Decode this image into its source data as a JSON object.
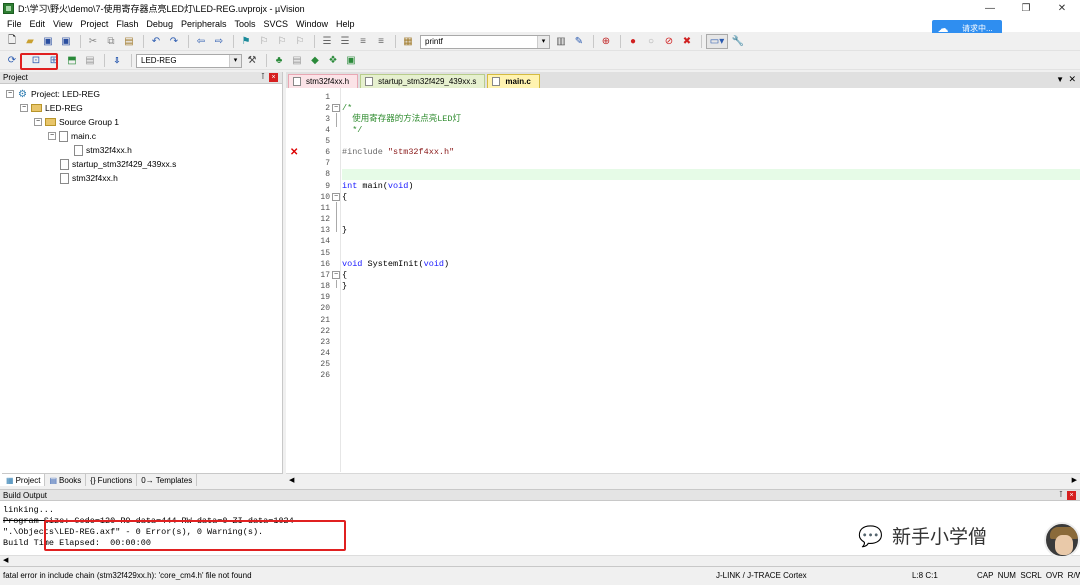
{
  "window": {
    "title": "D:\\学习\\野火\\demo\\7-使用寄存器点亮LED灯\\LED-REG.uvprojx - µVision"
  },
  "menu": [
    "File",
    "Edit",
    "View",
    "Project",
    "Flash",
    "Debug",
    "Peripherals",
    "Tools",
    "SVCS",
    "Window",
    "Help"
  ],
  "cloud_badge": {
    "label": "请求中..."
  },
  "toolbar": {
    "find_value": "printf",
    "target_value": "LED-REG"
  },
  "project_panel": {
    "title": "Project",
    "tree": {
      "project": "Project: LED-REG",
      "target": "LED-REG",
      "group": "Source Group 1",
      "files": [
        "main.c",
        "stm32f4xx.h",
        "startup_stm32f429_439xx.s",
        "stm32f4xx.h"
      ]
    },
    "tabs": [
      "Project",
      "Books",
      "Functions",
      "Templates"
    ]
  },
  "editor": {
    "tabs": [
      "stm32f4xx.h",
      "startup_stm32f429_439xx.s",
      "main.c"
    ],
    "line_numbers": [
      "1",
      "2",
      "3",
      "4",
      "5",
      "6",
      "7",
      "8",
      "9",
      "10",
      "11",
      "12",
      "13",
      "14",
      "15",
      "16",
      "17",
      "18",
      "19",
      "20",
      "21",
      "22",
      "23",
      "24",
      "25",
      "26"
    ],
    "code": {
      "l2": "/*",
      "l3": "  使用寄存器的方法点亮LED灯",
      "l4": "  */",
      "l6_pp": "#include ",
      "l6_str": "\"stm32f4xx.h\"",
      "l9_kw": "int",
      "l9_mid": " main(",
      "l9_kw2": "void",
      "l9_end": ")",
      "l10": "{",
      "l13": "}",
      "l16_kw": "void",
      "l16_mid": " SystemInit(",
      "l16_kw2": "void",
      "l16_end": ")",
      "l17": "{",
      "l18": "}"
    }
  },
  "build_output": {
    "title": "Build Output",
    "lines": [
      "linking...",
      "Program Size: Code=120 RO-data=444 RW-data=0 ZI-data=1024",
      "\".\\Objects\\LED-REG.axf\" - 0 Error(s), 0 Warning(s).",
      "Build Time Elapsed:  00:00:00"
    ]
  },
  "status_bar": {
    "message": "fatal error in include chain (stm32f429xx.h): 'core_cm4.h' file not found",
    "debugger": "J-LINK / J-TRACE Cortex",
    "position": "L:8 C:1",
    "indicators": "CAP  NUM  SCRL  OVR  R/W"
  },
  "watermark": {
    "text": "新手小学僧"
  }
}
